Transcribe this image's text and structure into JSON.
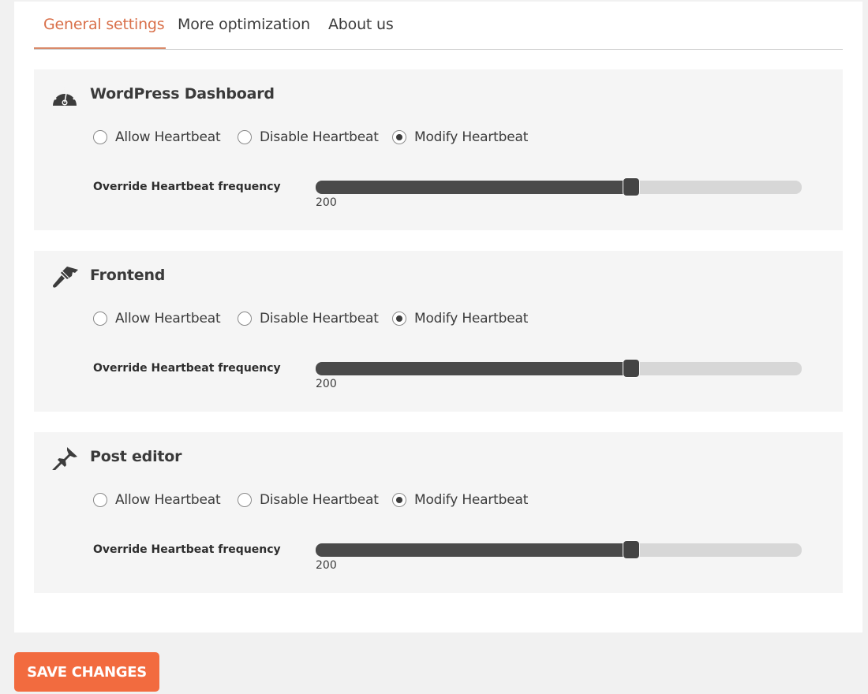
{
  "tabs": [
    {
      "label": "General settings",
      "active": true
    },
    {
      "label": "More optimization",
      "active": false
    },
    {
      "label": "About us",
      "active": false
    }
  ],
  "sections": [
    {
      "title": "WordPress Dashboard",
      "icon": "dashboard-gauge-icon",
      "options": [
        "Allow Heartbeat",
        "Disable Heartbeat",
        "Modify Heartbeat"
      ],
      "selected": "Modify Heartbeat",
      "frequency_label": "Override Heartbeat frequency",
      "frequency_value": "200",
      "frequency_fraction": 0.65
    },
    {
      "title": "Frontend",
      "icon": "paintbrush-icon",
      "options": [
        "Allow Heartbeat",
        "Disable Heartbeat",
        "Modify Heartbeat"
      ],
      "selected": "Modify Heartbeat",
      "frequency_label": "Override Heartbeat frequency",
      "frequency_value": "200",
      "frequency_fraction": 0.65
    },
    {
      "title": "Post editor",
      "icon": "pushpin-icon",
      "options": [
        "Allow Heartbeat",
        "Disable Heartbeat",
        "Modify Heartbeat"
      ],
      "selected": "Modify Heartbeat",
      "frequency_label": "Override Heartbeat frequency",
      "frequency_value": "200",
      "frequency_fraction": 0.65
    }
  ],
  "save_button": {
    "label": "SAVE CHANGES",
    "color": "#f26b3f"
  },
  "colors": {
    "accent": "#d9704a",
    "slider_fill": "#4a4a4a",
    "slider_track": "#d7d7d7"
  }
}
